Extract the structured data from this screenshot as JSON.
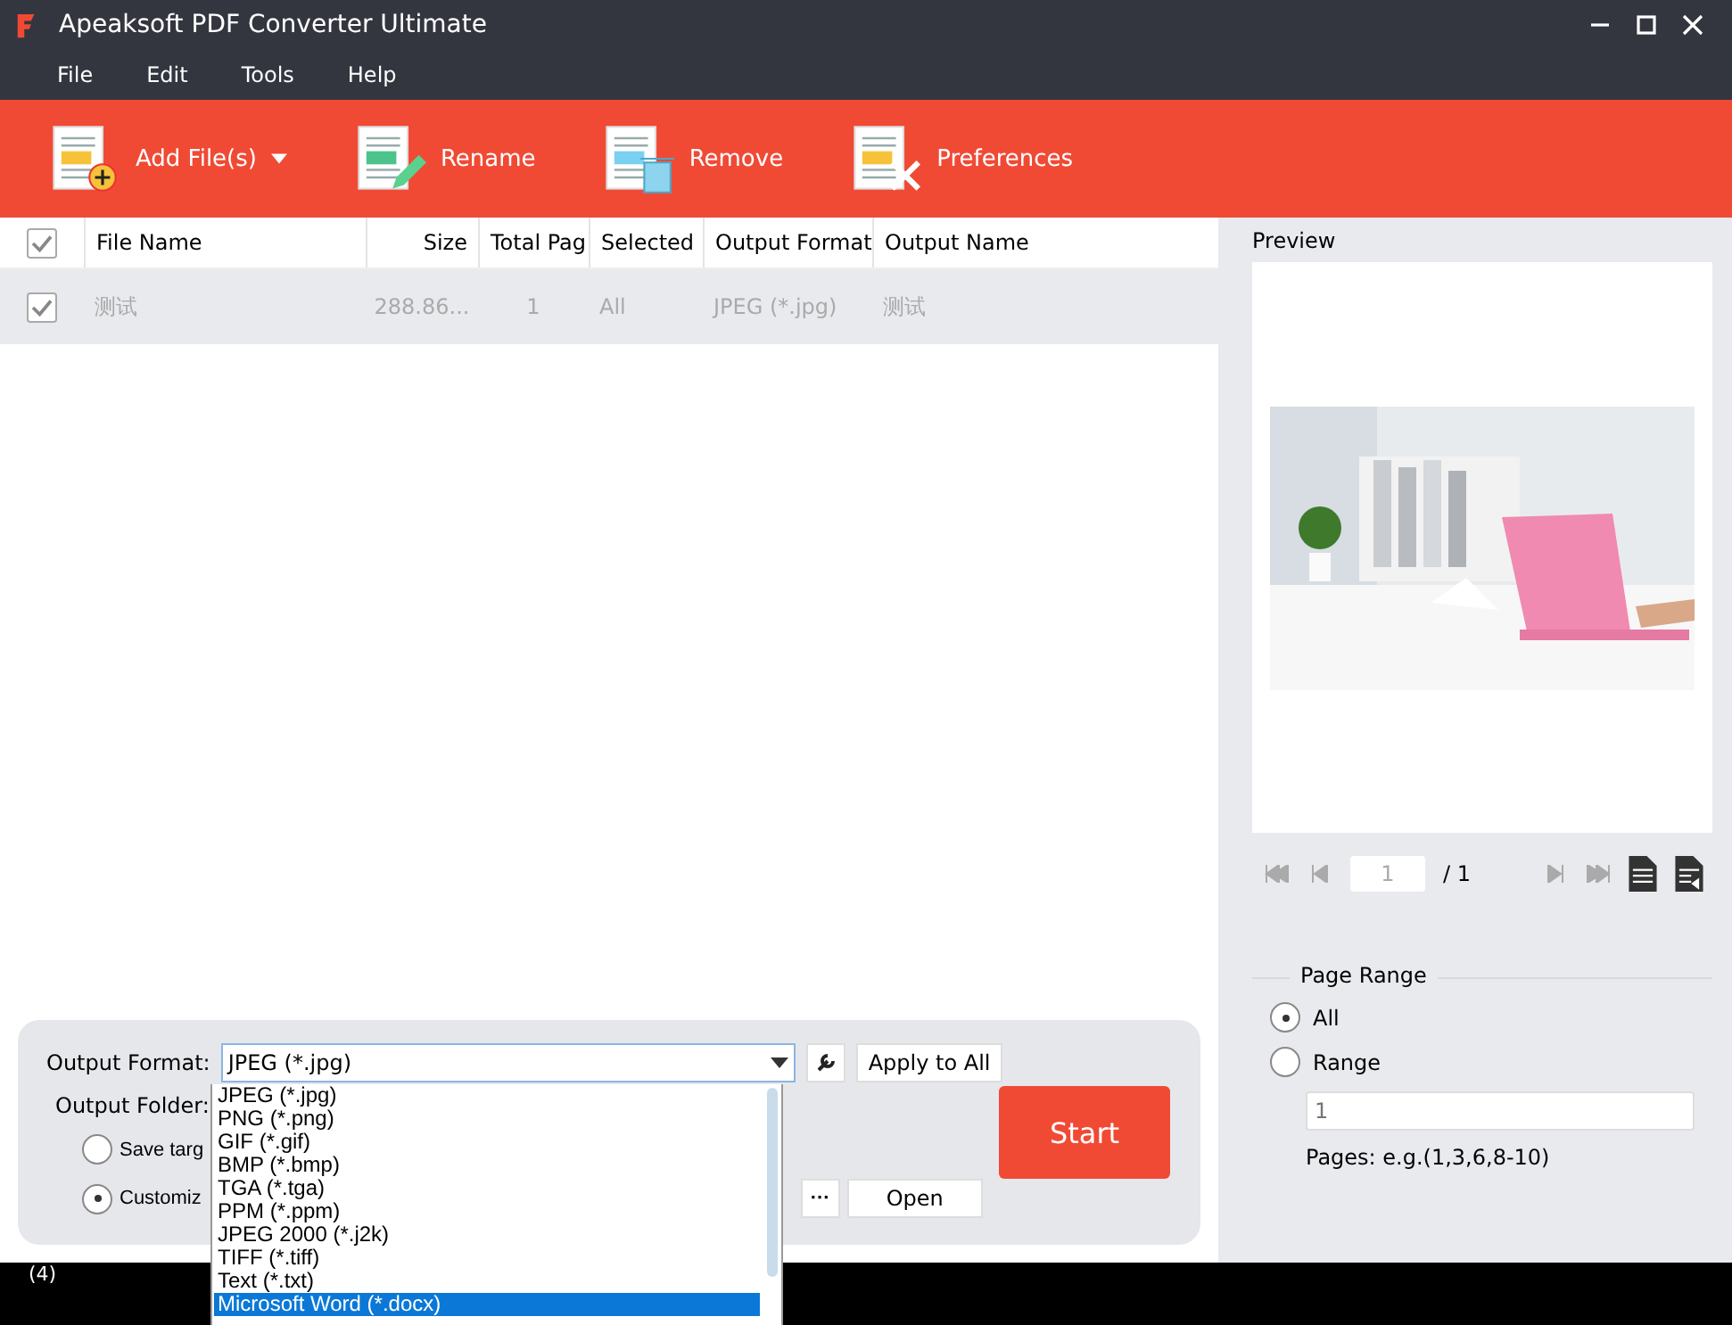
{
  "window": {
    "title": "Apeaksoft PDF Converter Ultimate"
  },
  "menu": [
    "File",
    "Edit",
    "Tools",
    "Help"
  ],
  "toolbar": [
    {
      "label": "Add File(s)",
      "kind": "add",
      "dropdown": true
    },
    {
      "label": "Rename",
      "kind": "rename",
      "dropdown": false
    },
    {
      "label": "Remove",
      "kind": "remove",
      "dropdown": false
    },
    {
      "label": "Preferences",
      "kind": "preferences",
      "dropdown": false
    }
  ],
  "table": {
    "all_checked": true,
    "columns": [
      "File Name",
      "Size",
      "Total Pag",
      "Selected",
      "Output Format",
      "Output Name"
    ],
    "rows": [
      {
        "checked": true,
        "cells": [
          "测试",
          "288.86...",
          "1",
          "All",
          "JPEG (*.jpg)",
          "测试"
        ]
      }
    ]
  },
  "output": {
    "format_label": "Output Format:",
    "format_value": "JPEG (*.jpg)",
    "apply_button": "Apply to All",
    "folder_label": "Output Folder:",
    "folder_options": [
      {
        "label": "Save targ",
        "selected": false
      },
      {
        "label": "Customiz",
        "selected": true
      }
    ],
    "browse_button": "···",
    "open_button": "Open",
    "start_button": "Start",
    "format_options": [
      {
        "label": "JPEG (*.jpg)",
        "selected": false
      },
      {
        "label": "PNG (*.png)",
        "selected": false
      },
      {
        "label": "GIF (*.gif)",
        "selected": false
      },
      {
        "label": "BMP (*.bmp)",
        "selected": false
      },
      {
        "label": "TGA (*.tga)",
        "selected": false
      },
      {
        "label": "PPM (*.ppm)",
        "selected": false
      },
      {
        "label": "JPEG 2000 (*.j2k)",
        "selected": false
      },
      {
        "label": "TIFF (*.tiff)",
        "selected": false
      },
      {
        "label": "Text (*.txt)",
        "selected": false
      },
      {
        "label": "Microsoft Word (*.docx)",
        "selected": true
      }
    ]
  },
  "preview": {
    "title": "Preview",
    "page_value": "1",
    "page_total": "/ 1"
  },
  "page_range": {
    "title": "Page Range",
    "options": [
      {
        "label": "All",
        "selected": true
      },
      {
        "label": "Range",
        "selected": false
      }
    ],
    "range_placeholder": "1",
    "hint": "Pages: e.g.(1,3,6,8-10)"
  },
  "status_bar": {
    "text": "(4)"
  }
}
